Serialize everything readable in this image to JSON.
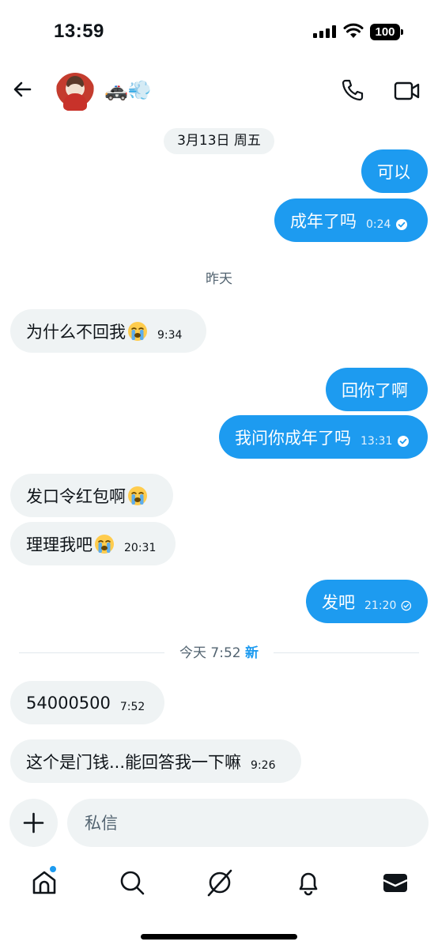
{
  "status_bar": {
    "time": "13:59",
    "battery": "100"
  },
  "header": {
    "contact_emoji": "🚓💨"
  },
  "date_header": "3月13日 周五",
  "messages_block_1": [
    {
      "text": "可以",
      "time": ""
    },
    {
      "text": "成年了吗",
      "time": "0:24"
    }
  ],
  "yesterday_label": "昨天",
  "messages_block_2": [
    {
      "text": "为什么不回我",
      "time": "9:34"
    },
    {
      "text": "回你了啊",
      "time": ""
    },
    {
      "text": "我问你成年了吗",
      "time": "13:31"
    },
    {
      "text": "发口令红包啊",
      "time": ""
    },
    {
      "text": "理理我吧",
      "time": "20:31"
    },
    {
      "text": "发吧",
      "time": "21:20"
    }
  ],
  "today_separator": {
    "label": "今天 7:52",
    "new_badge": "新"
  },
  "messages_block_3": [
    {
      "text": "54000500",
      "time": "7:52"
    },
    {
      "text": "这个是门钱...能回答我一下嘛",
      "time": "9:26"
    }
  ],
  "composer": {
    "placeholder": "私信"
  },
  "icons": [
    "back-arrow-icon",
    "phone-icon",
    "video-camera-icon",
    "crying-face-icon",
    "check-circle-icon",
    "plus-icon",
    "home-icon",
    "search-icon",
    "grok-icon",
    "bell-icon",
    "mail-icon"
  ],
  "colors": {
    "accent": "#1d9bf0",
    "incoming_bubble": "#eff3f4",
    "muted_text": "#536471"
  }
}
